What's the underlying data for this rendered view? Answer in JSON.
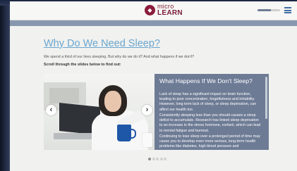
{
  "header": {
    "logo_top": "micro",
    "logo_bottom": "LEARN",
    "progress_fraction": 0.6
  },
  "page": {
    "title": "Why Do We Need Sleep?",
    "intro": "We spend a third of our lives sleeping. But why do we do it? And what happens if we don't?",
    "instruction": "Scroll through the slides below to find out:"
  },
  "slide": {
    "title": "What Happens If We Don't Sleep?",
    "paragraphs": [
      "Lack of sleep has a significant impact on brain function, leading to poor concentration, forgetfulness and irritability. However, long term lack of sleep, or sleep deprivation, can affect our health too.",
      "Consistently sleeping less than you should causes a sleep deficit to accumulate. Research has linked sleep deprivation to an increase in the stress hormone, cortisol, which can lead to mental fatigue and burnout.",
      "Continuing to lose sleep over a prolonged period of time may cause you to develop even more serious, long-term health problems like diabetes, high blood pressure and"
    ],
    "prev_arrow": "‹",
    "next_arrow": "›"
  },
  "pagination": {
    "count": 5,
    "active_index": 0
  },
  "colors": {
    "brand": "#8a1c3a",
    "heading": "#6aa6cf",
    "panel": "#6d7b95",
    "band": "#8797ae"
  },
  "icons": {
    "menu": "hamburger-icon",
    "prev": "chevron-left-icon",
    "next": "chevron-right-icon"
  }
}
